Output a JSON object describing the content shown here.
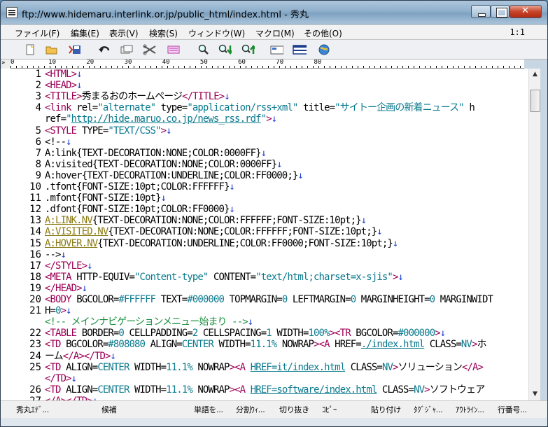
{
  "window": {
    "title": "ftp://www.hidemaru.interlink.or.jp/public_html/index.html  - 秀丸"
  },
  "menu": {
    "items": [
      "ファイル(F)",
      "編集(E)",
      "表示(V)",
      "検索(S)",
      "ウィンドウ(W)",
      "マクロ(M)",
      "その他(O)"
    ],
    "cursor_position": "1:1"
  },
  "toolbar": {
    "icons": [
      "new-file-icon",
      "open-folder-icon",
      "save-icon",
      "undo-icon",
      "copy-icon",
      "cut-icon",
      "paste-icon",
      "search-icon",
      "find-next-icon",
      "find-prev-icon",
      "window-icon",
      "split-icon",
      "globe-icon"
    ]
  },
  "ruler": {
    "marker": "»",
    "labels": "0         10        20        30        40        50        60        70        80"
  },
  "editor": {
    "line_numbers": [
      "1",
      "2",
      "3",
      "4",
      "",
      "5",
      "6",
      "7",
      "8",
      "9",
      "10",
      "11",
      "12",
      "13",
      "14",
      "15",
      "16",
      "17",
      "18",
      "19",
      "20",
      "21",
      "",
      "22",
      "23",
      "24",
      "25",
      "",
      "26",
      "27",
      "",
      "28",
      "29"
    ],
    "lines": [
      [
        [
          "tag",
          "<HTML>"
        ],
        [
          "cr",
          "↓"
        ]
      ],
      [
        [
          "tag",
          "<HEAD>"
        ],
        [
          "cr",
          "↓"
        ]
      ],
      [
        [
          "tag",
          "<TITLE>"
        ],
        [
          "hl",
          "秀まるおのホームページ"
        ],
        [
          "tag",
          "</TITLE>"
        ],
        [
          "cr",
          "↓"
        ]
      ],
      [
        [
          "tag",
          "<link "
        ],
        [
          "attr",
          "rel="
        ],
        [
          "str",
          "\"alternate\" "
        ],
        [
          "attr",
          "type="
        ],
        [
          "str",
          "\"application/rss+xml\" "
        ],
        [
          "attr",
          "title="
        ],
        [
          "str",
          "\"サイトー企画の新着ニュース\" "
        ],
        [
          "attr",
          "h"
        ]
      ],
      [
        [
          "attr",
          "ref="
        ],
        [
          "str",
          "\""
        ],
        [
          "str link",
          "http://hide.maruo.co.jp/news_rss.rdf"
        ],
        [
          "str",
          "\""
        ],
        [
          "tag",
          ">"
        ],
        [
          "cr",
          "↓"
        ]
      ],
      [
        [
          "tag",
          "<STYLE "
        ],
        [
          "attr",
          "TYPE="
        ],
        [
          "str",
          "\"TEXT/CSS\""
        ],
        [
          "tag",
          ">"
        ],
        [
          "cr",
          "↓"
        ]
      ],
      [
        [
          "hl",
          "<!--"
        ],
        [
          "cr",
          "↓"
        ]
      ],
      [
        [
          "hl",
          "A:link{TEXT-DECORATION:NONE;COLOR:0000FF}"
        ],
        [
          "cr",
          "↓"
        ]
      ],
      [
        [
          "hl",
          "A:visited{TEXT-DECORATION:NONE;COLOR:0000FF}"
        ],
        [
          "cr",
          "↓"
        ]
      ],
      [
        [
          "hl",
          "A:hover{TEXT-DECORATION:UNDERLINE;COLOR:FF0000;}"
        ],
        [
          "cr",
          "↓"
        ]
      ],
      [
        [
          "hl",
          ".tfont{FONT-SIZE:10pt;COLOR:FFFFFF}"
        ],
        [
          "cr",
          "↓"
        ]
      ],
      [
        [
          "hl",
          ".mfont{FONT-SIZE:10pt}"
        ],
        [
          "cr",
          "↓"
        ]
      ],
      [
        [
          "hl",
          ".dfont{FONT-SIZE:10pt;COLOR:FF0000}"
        ],
        [
          "cr",
          "↓"
        ]
      ],
      [
        [
          "vlink",
          "A:LINK.NV"
        ],
        [
          "hl",
          "{TEXT-DECORATION:NONE;COLOR:FFFFFF;FONT-SIZE:10pt;}"
        ],
        [
          "cr",
          "↓"
        ]
      ],
      [
        [
          "vlink",
          "A:VISITED.NV"
        ],
        [
          "hl",
          "{TEXT-DECORATION:NONE;COLOR:FFFFFF;FONT-SIZE:10pt;}"
        ],
        [
          "cr",
          "↓"
        ]
      ],
      [
        [
          "vlink",
          "A:HOVER.NV"
        ],
        [
          "hl",
          "{TEXT-DECORATION:UNDERLINE;COLOR:FF0000;FONT-SIZE:10pt;}"
        ],
        [
          "cr",
          "↓"
        ]
      ],
      [
        [
          "hl",
          "-->"
        ],
        [
          "cr",
          "↓"
        ]
      ],
      [
        [
          "tag",
          "</STYLE>"
        ],
        [
          "cr",
          "↓"
        ]
      ],
      [
        [
          "tag",
          "<META "
        ],
        [
          "attr",
          "HTTP-EQUIV="
        ],
        [
          "str",
          "\"Content-type\" "
        ],
        [
          "attr",
          "CONTENT="
        ],
        [
          "str",
          "\"text/html;charset=x-sjis\""
        ],
        [
          "tag",
          ">"
        ],
        [
          "cr",
          "↓"
        ]
      ],
      [
        [
          "tag",
          "</HEAD>"
        ],
        [
          "cr",
          "↓"
        ]
      ],
      [
        [
          "tag",
          "<BODY "
        ],
        [
          "attr",
          "BGCOLOR="
        ],
        [
          "str",
          "#FFFFFF "
        ],
        [
          "attr",
          "TEXT="
        ],
        [
          "str",
          "#000000 "
        ],
        [
          "attr",
          "TOPMARGIN="
        ],
        [
          "str",
          "0 "
        ],
        [
          "attr",
          "LEFTMARGIN="
        ],
        [
          "str",
          "0 "
        ],
        [
          "attr",
          "MARGINHEIGHT="
        ],
        [
          "str",
          "0 "
        ],
        [
          "attr",
          "MARGINWIDT"
        ]
      ],
      [
        [
          "attr",
          "H="
        ],
        [
          "str",
          "0"
        ],
        [
          "tag",
          ">"
        ],
        [
          "cr",
          "↓"
        ]
      ],
      [
        [
          "com",
          "<!-- メインナビゲーションメニュー始まり -->"
        ],
        [
          "cr",
          "↓"
        ]
      ],
      [
        [
          "tag",
          "<TABLE "
        ],
        [
          "attr",
          "BORDER="
        ],
        [
          "str",
          "0 "
        ],
        [
          "attr",
          "CELLPADDING="
        ],
        [
          "str",
          "2 "
        ],
        [
          "attr",
          "CELLSPACING="
        ],
        [
          "str",
          "1 "
        ],
        [
          "attr",
          "WIDTH="
        ],
        [
          "str",
          "100%"
        ],
        [
          "tag",
          "><TR "
        ],
        [
          "attr",
          "BGCOLOR="
        ],
        [
          "str",
          "#000000"
        ],
        [
          "tag",
          ">"
        ],
        [
          "cr",
          "↓"
        ]
      ],
      [
        [
          "tag",
          "<TD "
        ],
        [
          "attr",
          "BGCOLOR="
        ],
        [
          "str",
          "#808080 "
        ],
        [
          "attr",
          "ALIGN="
        ],
        [
          "str",
          "CENTER "
        ],
        [
          "attr",
          "WIDTH="
        ],
        [
          "str",
          "11.1% "
        ],
        [
          "attr",
          "NOWRAP"
        ],
        [
          "tag",
          "><A "
        ],
        [
          "attr",
          "HREF="
        ],
        [
          "str link",
          "./index.html"
        ],
        [
          "attr",
          " CLASS="
        ],
        [
          "str",
          "NV"
        ],
        [
          "tag",
          ">"
        ],
        [
          "hl",
          "ホ"
        ]
      ],
      [
        [
          "hl",
          "ーム"
        ],
        [
          "tag",
          "</A></TD>"
        ],
        [
          "cr",
          "↓"
        ]
      ],
      [
        [
          "tag",
          "<TD "
        ],
        [
          "attr",
          "ALIGN="
        ],
        [
          "str",
          "CENTER "
        ],
        [
          "attr",
          "WIDTH="
        ],
        [
          "str",
          "11.1% "
        ],
        [
          "attr",
          "NOWRAP"
        ],
        [
          "tag",
          "><A "
        ],
        [
          "str link",
          "HREF=it/index.html"
        ],
        [
          "attr",
          " CLASS="
        ],
        [
          "str",
          "NV"
        ],
        [
          "tag",
          ">"
        ],
        [
          "hl",
          "ソリューション"
        ],
        [
          "tag",
          "</A>"
        ]
      ],
      [
        [
          "tag",
          "</TD>"
        ],
        [
          "cr",
          "↓"
        ]
      ],
      [
        [
          "tag",
          "<TD "
        ],
        [
          "attr",
          "ALIGN="
        ],
        [
          "str",
          "CENTER "
        ],
        [
          "attr",
          "WIDTH="
        ],
        [
          "str",
          "11.1% "
        ],
        [
          "attr",
          "NOWRAP"
        ],
        [
          "tag",
          "><A "
        ],
        [
          "str link",
          "HREF=software/index.html"
        ],
        [
          "attr",
          " CLASS="
        ],
        [
          "str",
          "NV"
        ],
        [
          "tag",
          ">"
        ],
        [
          "hl",
          "ソフトウェア"
        ]
      ],
      [
        [
          "tag",
          "</A></TD>"
        ],
        [
          "cr",
          "↓"
        ]
      ]
    ]
  },
  "function_keys": [
    "秀丸ｴﾃﾞ...",
    "候補",
    "単語を...",
    "分割ｳｨ...",
    "切り抜き",
    "ｺﾋﾟｰ",
    "貼り付け",
    "ﾀｸﾞｼﾞｬ...",
    "ｱｳﾄﾗｲﾝ...",
    "行番号..."
  ]
}
